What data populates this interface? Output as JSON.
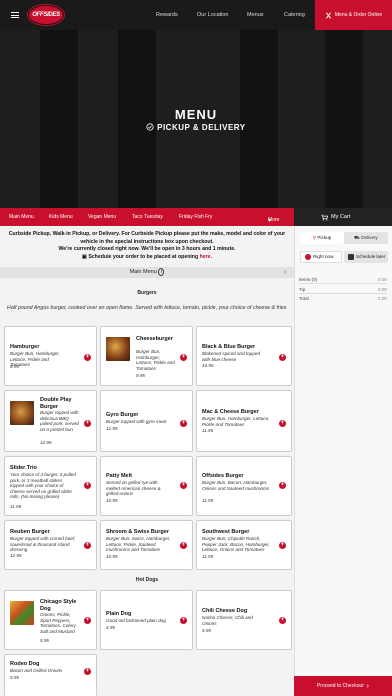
{
  "header": {
    "logo_text": "OFFSIDES",
    "nav": [
      "Rewards",
      "Our Location",
      "Menus",
      "Catering"
    ],
    "cta_label": "Menu & Order Online"
  },
  "hero": {
    "title": "MENU",
    "subtitle": "PICKUP & DELIVERY"
  },
  "tabs": [
    "Main Menu",
    "Kids Menu",
    "Vegan Menu",
    "Taco Tuesday",
    "Friday Fish Fry",
    "More"
  ],
  "cart": {
    "label": "My Cart"
  },
  "notice": {
    "line1": "Curbside Pickup, Walk-in Pickup, or Delivery. For Curbside Pickup please put the make, model and color of your vehicle in the special instructions box upon checkout.",
    "line2": "We're currently closed right now. We'll be open in 3 hours and 1 minute.",
    "line3_prefix": "Schedule your order to be placed at opening",
    "line3_link": "here"
  },
  "menubar": {
    "label": "Main Menu"
  },
  "sections": {
    "burgers": "Burgers",
    "hotdogs": "Hot Dogs"
  },
  "intro": "Half pound Angus burger, cooked over an open flame. Served with lettuce, tomato, pickle, your choice of cheese & fries",
  "items": [
    {
      "name": "Hamburger",
      "desc": "Burger Bun, Hamburger, Lettuce, Pickle and Tomatoes",
      "price": "8.95"
    },
    {
      "name": "Cheeseburger",
      "desc": "Burger Bun, Hamburger, Lettuce, Pickle and Tomatoes",
      "price": "9.95"
    },
    {
      "name": "Black & Blue Burger",
      "desc": "Blakened spiced and topped with blue cheese",
      "price": "10.95"
    },
    {
      "name": "Double Play Burger",
      "desc": "Burger topped with delicious BBQ pulled pork, served on a pretzel bun",
      "price": "12.95"
    },
    {
      "name": "Gyro Burger",
      "desc": "Burger topped with gyro meat",
      "price": "12.95"
    },
    {
      "name": "Mac & Cheese Burger",
      "desc": "Burger Bun, Hamburger, Lettuce, Pickle and Tomatoes",
      "price": "11.95"
    },
    {
      "name": "Slider Trio",
      "desc": "Your choice of 3 burger, 3 pulled pork, or 3 meatball sliders topped with your choice of cheese served on grilled slider rolls. (No mixing please)",
      "price": "11.95"
    },
    {
      "name": "Patty Melt",
      "desc": "Served on grilled rye with melted American cheese & grilled onions",
      "price": "10.95"
    },
    {
      "name": "Offsides Burger",
      "desc": "Burger Bun, Bacon, Hamburger, Onions and Sauteed mushrooms",
      "price": "11.95"
    },
    {
      "name": "Reuben Burger",
      "desc": "Burger topped with corned beef, sauerkraut & thousand island dressing",
      "price": "12.95"
    },
    {
      "name": "Shroom & Swiss Burger",
      "desc": "Burger Bun, Swiss, Hamburger, Lettuce, Pickle, Sauteed mushrooms and Tomatoes",
      "price": "10.95"
    },
    {
      "name": "Southwest Burger",
      "desc": "Burger Bun, Chipotle Ranch, Pepper Jack, Bacon, Hamburger, Lettuce, Onions and Tomatoes",
      "price": "11.95"
    },
    {
      "name": "Chicago Style Dog",
      "desc": "Onions, Pickle, Sport Peppers, Tomatoes, Celery Salt and Mustard",
      "price": "5.95"
    },
    {
      "name": "Plain Dog",
      "desc": "Good old fashioned plain dog",
      "price": "4.95"
    },
    {
      "name": "Chili Cheese Dog",
      "desc": "Nacho Cheese, Chili and Onions",
      "price": "5.95"
    },
    {
      "name": "Rodeo Dog",
      "desc": "Bacon and Grilled Onions",
      "price": "5.95"
    }
  ],
  "sidebar": {
    "pickup": "Pickup",
    "delivery": "Delivery",
    "right_now": "Right now",
    "schedule_later": "Schedule later",
    "totals": [
      {
        "label": "Items (0)",
        "value": "0.00"
      },
      {
        "label": "Tip",
        "value": "0.00"
      },
      {
        "label": "Total",
        "value": "0.00"
      }
    ],
    "checkout": "Proceed to Checkout"
  },
  "colors": {
    "accent": "#c8102e",
    "dark": "#1a1a1a"
  }
}
